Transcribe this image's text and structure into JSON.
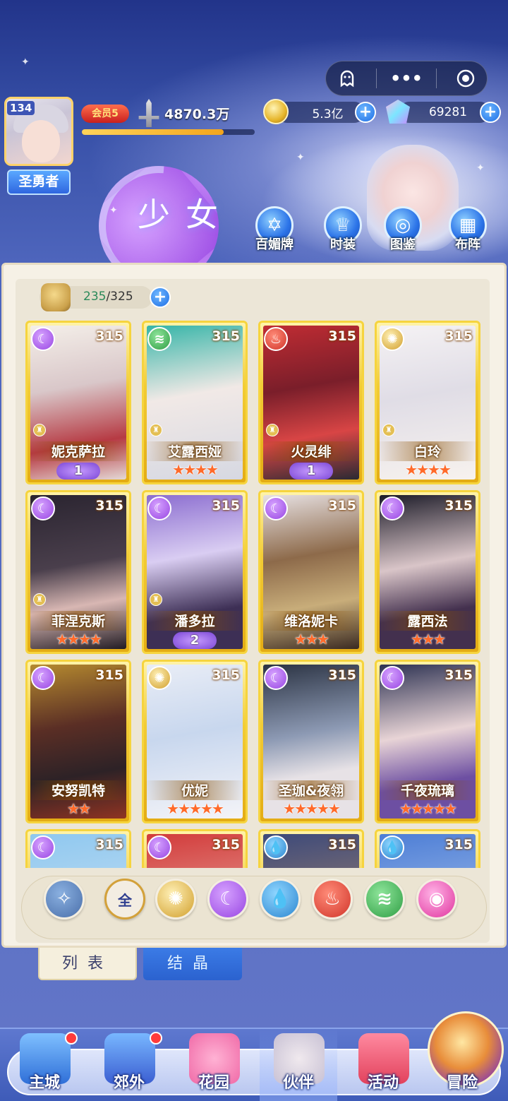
{
  "header": {
    "level": "134",
    "title_badge": "圣勇者",
    "vip": "会员5",
    "power": "4870.3万",
    "xp_progress": 0.82,
    "gold": "5.3亿",
    "gems": "69281",
    "page_title": "少女"
  },
  "capsule": {
    "icons": [
      "ghost-icon",
      "more-icon",
      "target-icon"
    ],
    "more_label": "•••"
  },
  "top_buttons": [
    {
      "label": "百媚牌",
      "icon": "card-icon"
    },
    {
      "label": "时装",
      "icon": "outfit-icon"
    },
    {
      "label": "图鉴",
      "icon": "book-icon"
    },
    {
      "label": "布阵",
      "icon": "formation-icon"
    }
  ],
  "roster": {
    "current": "235",
    "max": "/325",
    "plus": "+"
  },
  "cards": [
    {
      "name": "妮克萨拉",
      "level": "315",
      "element": "moon",
      "stars": "",
      "badge": "1",
      "locked": true
    },
    {
      "name": "艾露西娅",
      "level": "315",
      "element": "wind",
      "stars": "★★★★",
      "badge": "",
      "locked": true
    },
    {
      "name": "火灵绯",
      "level": "315",
      "element": "fire",
      "stars": "",
      "badge": "1",
      "locked": true
    },
    {
      "name": "白玲",
      "level": "315",
      "element": "sun",
      "stars": "★★★★",
      "badge": "",
      "locked": true
    },
    {
      "name": "菲涅克斯",
      "level": "315",
      "element": "moon",
      "stars": "★★★★",
      "badge": "",
      "locked": true
    },
    {
      "name": "潘多拉",
      "level": "315",
      "element": "moon",
      "stars": "",
      "badge": "2",
      "locked": true
    },
    {
      "name": "维洛妮卡",
      "level": "315",
      "element": "moon",
      "stars": "★★★",
      "badge": "",
      "locked": false
    },
    {
      "name": "露西法",
      "level": "315",
      "element": "moon",
      "stars": "★★★",
      "badge": "",
      "locked": false
    },
    {
      "name": "安努凯特",
      "level": "315",
      "element": "moon",
      "stars": "★★",
      "badge": "",
      "locked": false
    },
    {
      "name": "优妮",
      "level": "315",
      "element": "sun",
      "stars": "★★★★★",
      "badge": "",
      "locked": false
    },
    {
      "name": "圣珈&夜翎",
      "level": "315",
      "element": "moon",
      "stars": "★★★★★",
      "badge": "",
      "locked": false
    },
    {
      "name": "千夜琉璃",
      "level": "315",
      "element": "moon",
      "stars": "★★★★★",
      "badge": "",
      "locked": false
    },
    {
      "name": "",
      "level": "315",
      "element": "moon",
      "stars": "",
      "badge": "",
      "locked": false
    },
    {
      "name": "",
      "level": "315",
      "element": "moon",
      "stars": "",
      "badge": "",
      "locked": false
    },
    {
      "name": "",
      "level": "315",
      "element": "water",
      "stars": "",
      "badge": "",
      "locked": false
    },
    {
      "name": "",
      "level": "315",
      "element": "water",
      "stars": "",
      "badge": "",
      "locked": false
    }
  ],
  "filters": {
    "all_label": "全",
    "items": [
      "mode",
      "all",
      "sun",
      "moon",
      "water",
      "fire",
      "wind",
      "star"
    ]
  },
  "tabs": {
    "list": "列表",
    "crystal": "结晶"
  },
  "nav": [
    {
      "label": "主城",
      "dot": true
    },
    {
      "label": "郊外",
      "dot": true
    },
    {
      "label": "花园",
      "dot": false
    },
    {
      "label": "伙伴",
      "dot": false
    },
    {
      "label": "活动",
      "dot": false
    },
    {
      "label": "冒险",
      "dot": false
    }
  ],
  "colors": {
    "accent": "#2b73e8",
    "gold": "#f2cc35",
    "panel": "#f6f1e6"
  }
}
